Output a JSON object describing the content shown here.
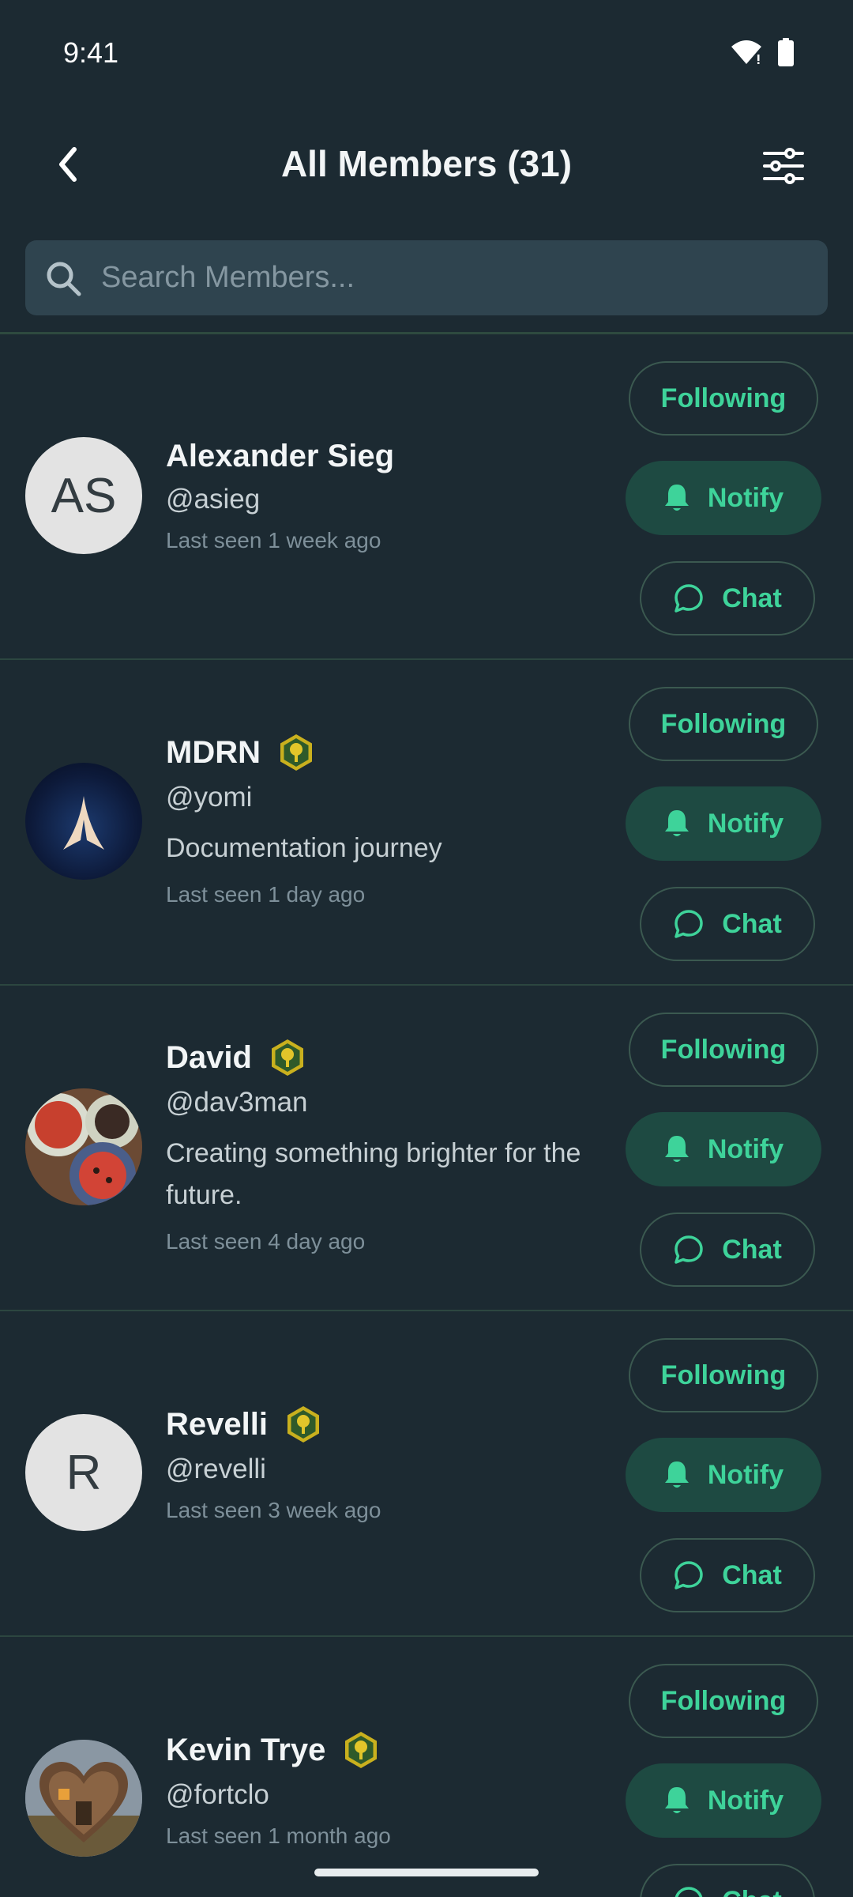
{
  "status_bar": {
    "time": "9:41"
  },
  "header": {
    "title": "All Members (31)"
  },
  "search": {
    "placeholder": "Search Members...",
    "value": ""
  },
  "actions": {
    "following_label": "Following",
    "notify_label": "Notify",
    "chat_label": "Chat"
  },
  "members": [
    {
      "name": "Alexander Sieg",
      "handle": "@asieg",
      "bio": "",
      "last_seen": "Last seen 1 week ago",
      "initials": "AS",
      "badge": false
    },
    {
      "name": "MDRN",
      "handle": "@yomi",
      "bio": "Documentation journey",
      "last_seen": "Last seen 1 day ago",
      "initials": "",
      "badge": true
    },
    {
      "name": "David",
      "handle": "@dav3man",
      "bio": "Creating something brighter for the future.",
      "last_seen": "Last seen 4 day ago",
      "initials": "",
      "badge": true
    },
    {
      "name": "Revelli",
      "handle": "@revelli",
      "bio": "",
      "last_seen": "Last seen 3 week ago",
      "initials": "R",
      "badge": true
    },
    {
      "name": "Kevin Trye",
      "handle": "@fortclo",
      "bio": "",
      "last_seen": "Last seen 1 month ago",
      "initials": "",
      "badge": true
    }
  ],
  "colors": {
    "background": "#1c2a32",
    "accent": "#3ed39a",
    "notify_bg": "#1e4a42",
    "search_bg": "#2f444f"
  }
}
